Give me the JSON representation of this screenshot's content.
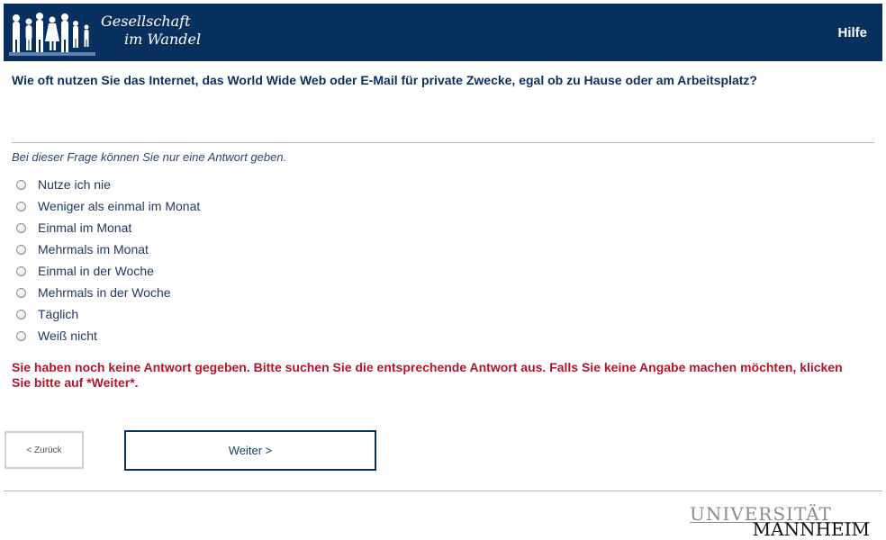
{
  "header": {
    "logo_line1": "Gesellschaft",
    "logo_line2": "im Wandel",
    "help_label": "Hilfe",
    "background_color": "#08305f"
  },
  "question": "Wie oft nutzen Sie das Internet, das World Wide Web oder E-Mail für private Zwecke, egal ob zu Hause oder am Arbeitsplatz?",
  "instruction": "Bei dieser Frage können Sie nur eine Antwort geben.",
  "options": [
    "Nutze ich nie",
    "Weniger als einmal im Monat",
    "Einmal im Monat",
    "Mehrmals im Monat",
    "Einmal in der Woche",
    "Mehrmals in der Woche",
    "Täglich",
    "Weiß nicht"
  ],
  "error": {
    "text": "Sie haben noch keine Antwort gegeben. Bitte suchen Sie die entsprechende Antwort aus. Falls Sie keine Angabe machen möchten, klicken Sie bitte auf *Weiter*.",
    "color": "#b0162e"
  },
  "nav": {
    "back_label": "< Zurück",
    "next_label": "Weiter >"
  },
  "footer": {
    "university_line1": "UNIVERSITÄT",
    "university_line2": "MANNHEIM"
  }
}
